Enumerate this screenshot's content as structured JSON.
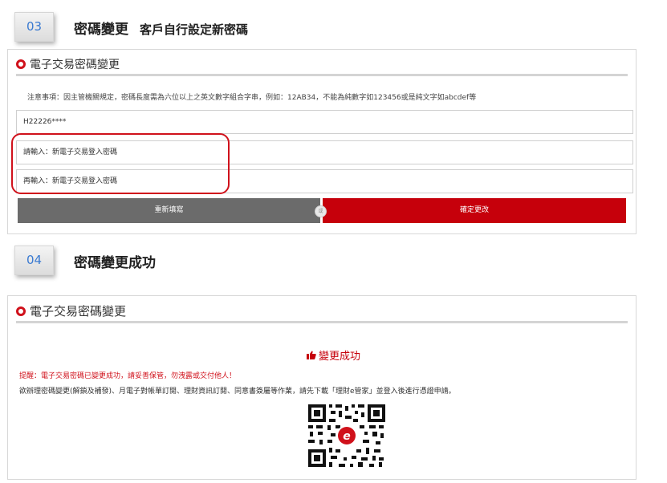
{
  "step3": {
    "number": "03",
    "title": "密碼變更",
    "subtitle": "客戶自行設定新密碼"
  },
  "panel1": {
    "heading": "電子交易密碼變更",
    "notice": "注意事項：因主管機關規定，密碼長度需為六位以上之英文數字組合字串，例如：12AB34，不能為純數字如123456或是純文字如abcdef等",
    "id_value": "H22226****",
    "new_password_placeholder": "請輸入：新電子交易登入密碼",
    "confirm_password_placeholder": "再輸入：新電子交易登入密碼",
    "reset_label": "重新填寫",
    "or_label": "或",
    "confirm_label": "確定更改"
  },
  "step4": {
    "number": "04",
    "title": "密碼變更成功"
  },
  "panel2": {
    "heading": "電子交易密碼變更",
    "success": "變更成功",
    "warning": "提醒：電子交易密碼已變更成功，請妥善保管，勿洩露或交付他人！",
    "info": "欲辦理密碼變更(解鎖及補發)、月電子對帳單訂閱、理財資訊訂閱、同意書簽屬等作業，請先下載「理財e管家」並登入後進行憑證申請。"
  },
  "colors": {
    "accent_red": "#d0111b",
    "button_red": "#c6000b",
    "button_gray": "#6b6b6b",
    "step_blue": "#3a7ad1"
  },
  "icons": {
    "heading_marker": "ring-icon",
    "success": "thumbs-up-icon",
    "qr": "qr-code-icon"
  }
}
